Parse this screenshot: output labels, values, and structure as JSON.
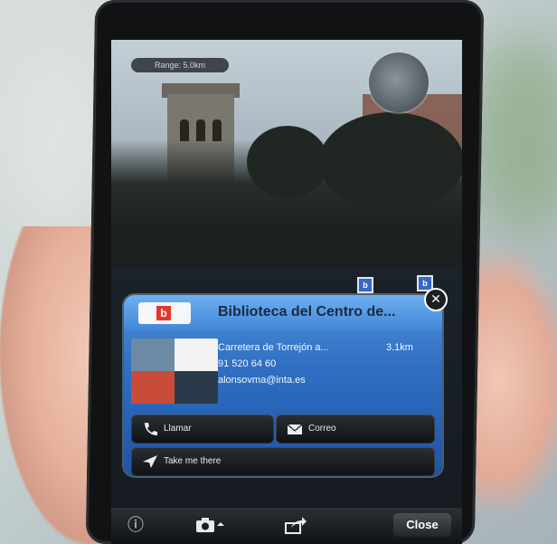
{
  "ar_view": {
    "range_label": "Range: 5.0km",
    "markers": [
      "b",
      "b"
    ]
  },
  "card": {
    "logo_letter": "b",
    "title": "Biblioteca del Centro de...",
    "address": "Carretera de Torrejón a...",
    "distance": "3.1km",
    "phone": "91 520 64 60",
    "email": "alonsovma@inta.es",
    "buttons": {
      "call": "Llamar",
      "mail": "Correo",
      "directions": "Take me there"
    }
  },
  "toolbar": {
    "close_label": "Close"
  },
  "colors": {
    "card_top": "#4c8fd8",
    "card_bottom": "#1f54a4",
    "logo_red": "#e0392c"
  }
}
